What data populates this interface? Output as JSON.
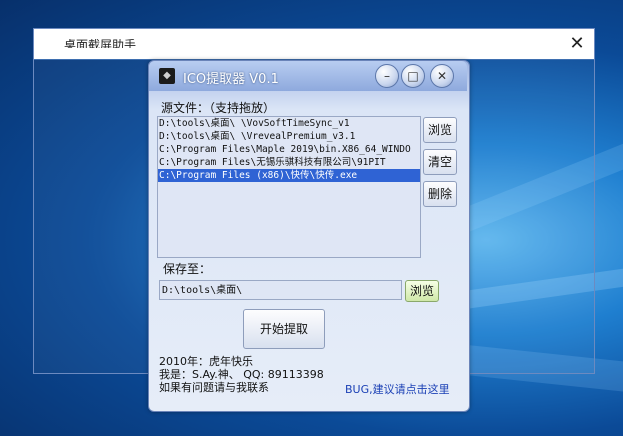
{
  "capture_window": {
    "title": "桌面截屏助手",
    "close_label": "✕"
  },
  "app": {
    "title": "ICO提取器 V0.1",
    "controls": {
      "minimize": "–",
      "maximize": "□",
      "close": "✕"
    },
    "source_label": "源文件：（支持拖放）",
    "files": [
      "D:\\tools\\桌面\\            \\VovSoftTimeSync_v1",
      "D:\\tools\\桌面\\            \\VrevealPremium_v3.1",
      "C:\\Program Files\\Maple 2019\\bin.X86_64_WINDO",
      "C:\\Program Files\\无锡乐骐科技有限公司\\91PIT",
      "C:\\Program Files (x86)\\快传\\快传.exe"
    ],
    "selected_index": 4,
    "buttons": {
      "browse": "浏览",
      "clear": "清空",
      "delete": "删除",
      "browse_save": "浏览",
      "start": "开始提取"
    },
    "save_label": "保存至：",
    "save_path": "D:\\tools\\桌面\\",
    "info_lines": [
      "2010年：虎年快乐",
      "我是：S.Ay.神、 QQ: 89113398",
      "如果有问题请与我联系"
    ],
    "bug_link": "BUG,建议请点击这里"
  }
}
